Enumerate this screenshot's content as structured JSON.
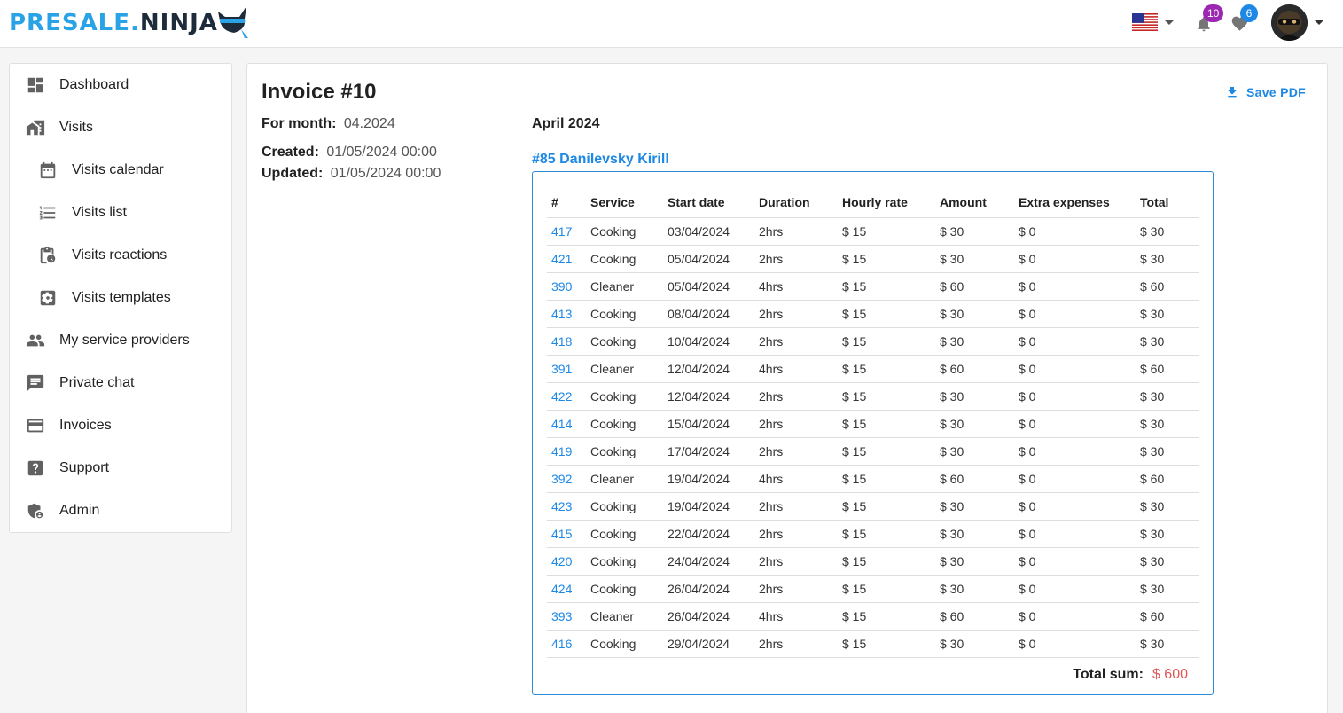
{
  "brand": {
    "part1": "PRESALE.",
    "part2": "NINJA"
  },
  "header": {
    "notifications_count": "10",
    "favorites_count": "6",
    "colors": {
      "notif_badge": "#9c27b0",
      "fav_badge": "#1e88e5"
    }
  },
  "sidebar": {
    "items": [
      {
        "label": "Dashboard"
      },
      {
        "label": "Visits"
      },
      {
        "label": "Visits calendar"
      },
      {
        "label": "Visits list"
      },
      {
        "label": "Visits reactions"
      },
      {
        "label": "Visits templates"
      },
      {
        "label": "My service providers"
      },
      {
        "label": "Private chat"
      },
      {
        "label": "Invoices"
      },
      {
        "label": "Support"
      },
      {
        "label": "Admin"
      }
    ]
  },
  "invoice": {
    "title": "Invoice #10",
    "for_month_label": "For month:",
    "for_month_value": "04.2024",
    "created_label": "Created:",
    "created_value": "01/05/2024 00:00",
    "updated_label": "Updated:",
    "updated_value": "01/05/2024 00:00",
    "save_pdf": "Save PDF",
    "month_title": "April 2024",
    "client": "#85 Danilevsky Kirill",
    "columns": [
      "#",
      "Service",
      "Start date",
      "Duration",
      "Hourly rate",
      "Amount",
      "Extra expenses",
      "Total"
    ],
    "rows": [
      [
        "417",
        "Cooking",
        "03/04/2024",
        "2hrs",
        "$ 15",
        "$ 30",
        "$ 0",
        "$ 30"
      ],
      [
        "421",
        "Cooking",
        "05/04/2024",
        "2hrs",
        "$ 15",
        "$ 30",
        "$ 0",
        "$ 30"
      ],
      [
        "390",
        "Cleaner",
        "05/04/2024",
        "4hrs",
        "$ 15",
        "$ 60",
        "$ 0",
        "$ 60"
      ],
      [
        "413",
        "Cooking",
        "08/04/2024",
        "2hrs",
        "$ 15",
        "$ 30",
        "$ 0",
        "$ 30"
      ],
      [
        "418",
        "Cooking",
        "10/04/2024",
        "2hrs",
        "$ 15",
        "$ 30",
        "$ 0",
        "$ 30"
      ],
      [
        "391",
        "Cleaner",
        "12/04/2024",
        "4hrs",
        "$ 15",
        "$ 60",
        "$ 0",
        "$ 60"
      ],
      [
        "422",
        "Cooking",
        "12/04/2024",
        "2hrs",
        "$ 15",
        "$ 30",
        "$ 0",
        "$ 30"
      ],
      [
        "414",
        "Cooking",
        "15/04/2024",
        "2hrs",
        "$ 15",
        "$ 30",
        "$ 0",
        "$ 30"
      ],
      [
        "419",
        "Cooking",
        "17/04/2024",
        "2hrs",
        "$ 15",
        "$ 30",
        "$ 0",
        "$ 30"
      ],
      [
        "392",
        "Cleaner",
        "19/04/2024",
        "4hrs",
        "$ 15",
        "$ 60",
        "$ 0",
        "$ 60"
      ],
      [
        "423",
        "Cooking",
        "19/04/2024",
        "2hrs",
        "$ 15",
        "$ 30",
        "$ 0",
        "$ 30"
      ],
      [
        "415",
        "Cooking",
        "22/04/2024",
        "2hrs",
        "$ 15",
        "$ 30",
        "$ 0",
        "$ 30"
      ],
      [
        "420",
        "Cooking",
        "24/04/2024",
        "2hrs",
        "$ 15",
        "$ 30",
        "$ 0",
        "$ 30"
      ],
      [
        "424",
        "Cooking",
        "26/04/2024",
        "2hrs",
        "$ 15",
        "$ 30",
        "$ 0",
        "$ 30"
      ],
      [
        "393",
        "Cleaner",
        "26/04/2024",
        "4hrs",
        "$ 15",
        "$ 60",
        "$ 0",
        "$ 60"
      ],
      [
        "416",
        "Cooking",
        "29/04/2024",
        "2hrs",
        "$ 15",
        "$ 30",
        "$ 0",
        "$ 30"
      ]
    ],
    "total_label": "Total sum:",
    "total_value": "$ 600"
  }
}
